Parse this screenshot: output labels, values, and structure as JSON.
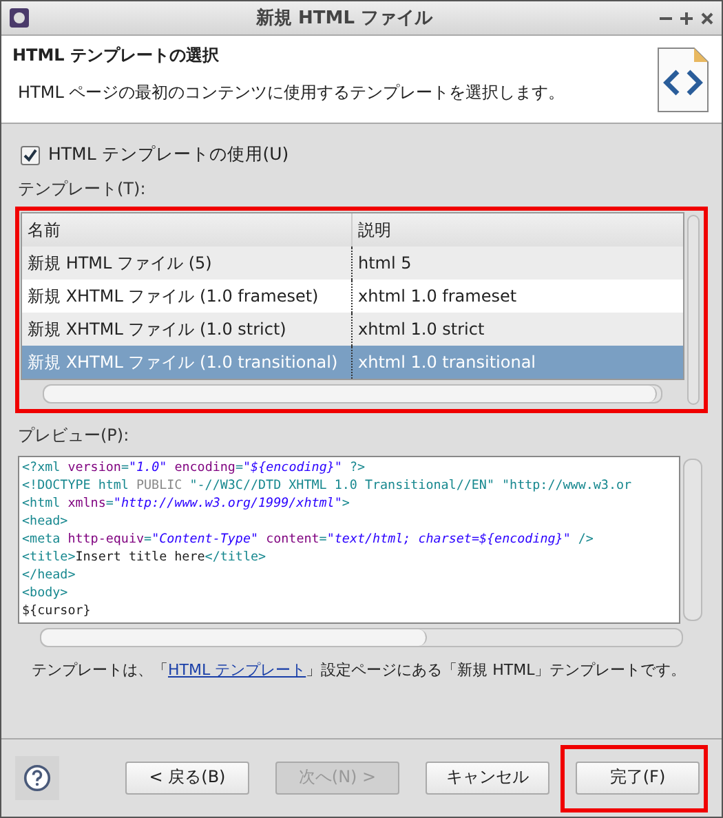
{
  "window": {
    "title": "新規 HTML ファイル"
  },
  "header": {
    "title": "HTML テンプレートの選択",
    "description": "HTML ページの最初のコンテンツに使用するテンプレートを選択します。"
  },
  "use_template": {
    "label": "HTML テンプレートの使用(U)",
    "checked": true
  },
  "templates": {
    "label": "テンプレート(T):",
    "highlighted": true,
    "columns": [
      "名前",
      "説明"
    ],
    "rows": [
      {
        "name": "新規 HTML ファイル (5)",
        "description": "html 5",
        "selected": false
      },
      {
        "name": "新規 XHTML ファイル (1.0 frameset)",
        "description": "xhtml 1.0 frameset",
        "selected": false
      },
      {
        "name": "新規 XHTML ファイル (1.0 strict)",
        "description": "xhtml 1.0 strict",
        "selected": false
      },
      {
        "name": "新規 XHTML ファイル (1.0 transitional)",
        "description": "xhtml 1.0 transitional",
        "selected": true
      }
    ]
  },
  "preview": {
    "label": "プレビュー(P):",
    "lines": [
      [
        {
          "kind": "tag",
          "text": "<?xml "
        },
        {
          "kind": "attr",
          "text": "version"
        },
        {
          "kind": "tag",
          "text": "="
        },
        {
          "kind": "value",
          "text": "\"1.0\""
        },
        {
          "kind": "attr",
          "text": " encoding"
        },
        {
          "kind": "tag",
          "text": "="
        },
        {
          "kind": "value",
          "text": "\"${encoding}\""
        },
        {
          "kind": "tag",
          "text": " ?>"
        }
      ],
      [
        {
          "kind": "tag",
          "text": "<!DOCTYPE html "
        },
        {
          "kind": "doctype",
          "text": "PUBLIC"
        },
        {
          "kind": "tag",
          "text": " \"-//W3C//DTD XHTML 1.0 Transitional//EN\" \"http://www.w3.or"
        }
      ],
      [
        {
          "kind": "tag",
          "text": "<html "
        },
        {
          "kind": "attr",
          "text": "xmlns"
        },
        {
          "kind": "tag",
          "text": "="
        },
        {
          "kind": "value",
          "text": "\"http://www.w3.org/1999/xhtml\""
        },
        {
          "kind": "tag",
          "text": ">"
        }
      ],
      [
        {
          "kind": "tag",
          "text": "<head>"
        }
      ],
      [
        {
          "kind": "tag",
          "text": "<meta "
        },
        {
          "kind": "attr",
          "text": "http-equiv"
        },
        {
          "kind": "tag",
          "text": "="
        },
        {
          "kind": "value",
          "text": "\"Content-Type\""
        },
        {
          "kind": "attr",
          "text": " content"
        },
        {
          "kind": "tag",
          "text": "="
        },
        {
          "kind": "value",
          "text": "\"text/html; charset=${encoding}\""
        },
        {
          "kind": "tag",
          "text": " />"
        }
      ],
      [
        {
          "kind": "tag",
          "text": "<title>"
        },
        {
          "kind": "text",
          "text": "Insert title here"
        },
        {
          "kind": "tag",
          "text": "</title>"
        }
      ],
      [
        {
          "kind": "tag",
          "text": "</head>"
        }
      ],
      [
        {
          "kind": "tag",
          "text": "<body>"
        }
      ],
      [
        {
          "kind": "text",
          "text": "${cursor}"
        }
      ]
    ]
  },
  "note": {
    "before": "テンプレートは、「",
    "link": "HTML テンプレート",
    "after": "」設定ページにある「新規 HTML」テンプレートです。"
  },
  "buttons": [
    {
      "label": "< 戻る(B)",
      "disabled": false,
      "highlighted": false
    },
    {
      "label": "次へ(N) >",
      "disabled": true,
      "highlighted": false
    },
    {
      "label": "キャンセル",
      "disabled": false,
      "highlighted": false
    },
    {
      "label": "完了(F)",
      "disabled": false,
      "highlighted": true
    }
  ]
}
